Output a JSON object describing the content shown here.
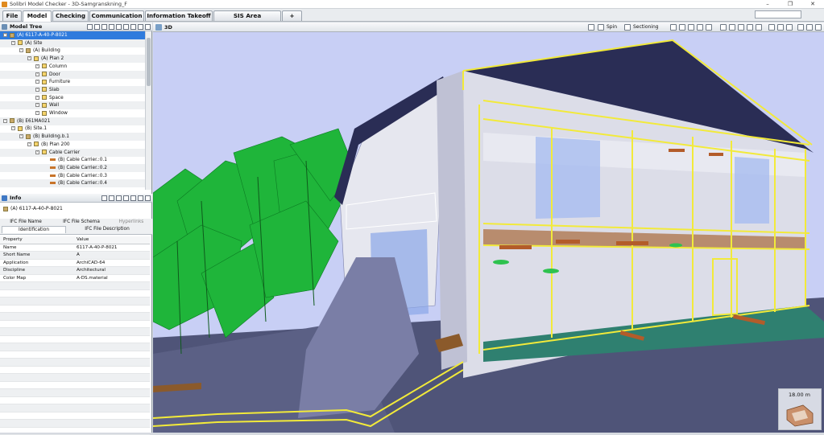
{
  "window": {
    "title": "Solibri Model Checker - 3D-Samgranskning_F",
    "controls": [
      "–",
      "❐",
      "✕"
    ]
  },
  "tabs": [
    {
      "label": "File",
      "active": false
    },
    {
      "label": "Model",
      "active": true
    },
    {
      "label": "Checking",
      "active": false
    },
    {
      "label": "Communication",
      "active": false
    },
    {
      "label": "Information Takeoff",
      "active": false
    },
    {
      "label": "SIS Area Calculation",
      "active": false
    },
    {
      "label": "+",
      "active": false
    }
  ],
  "model_tree": {
    "title": "Model Tree",
    "rows": [
      {
        "text": "(A) 6117-A-40-P-8021",
        "indent": 0,
        "icon": "bldg",
        "selected": true
      },
      {
        "text": "(A) Site",
        "indent": 1,
        "icon": "folder"
      },
      {
        "text": "(A) Building",
        "indent": 2,
        "icon": "bldg"
      },
      {
        "text": "(A) Plan 2",
        "indent": 3,
        "icon": "folder"
      },
      {
        "text": "Column",
        "indent": 4,
        "icon": "folder"
      },
      {
        "text": "Door",
        "indent": 4,
        "icon": "folder"
      },
      {
        "text": "Furniture",
        "indent": 4,
        "icon": "folder"
      },
      {
        "text": "Slab",
        "indent": 4,
        "icon": "folder"
      },
      {
        "text": "Space",
        "indent": 4,
        "icon": "folder"
      },
      {
        "text": "Wall",
        "indent": 4,
        "icon": "folder"
      },
      {
        "text": "Window",
        "indent": 4,
        "icon": "folder"
      },
      {
        "text": "(B) E61MA021",
        "indent": 0,
        "icon": "bldg"
      },
      {
        "text": "(B) Site.1",
        "indent": 1,
        "icon": "folder"
      },
      {
        "text": "(B) Building.b.1",
        "indent": 2,
        "icon": "bldg"
      },
      {
        "text": "(B) Plan 200",
        "indent": 3,
        "icon": "folder"
      },
      {
        "text": "Cable Carrier",
        "indent": 4,
        "icon": "folder"
      },
      {
        "text": "(B) Cable Carrier.:0.1",
        "indent": 5,
        "icon": "cable"
      },
      {
        "text": "(B) Cable Carrier.:0.2",
        "indent": 5,
        "icon": "cable"
      },
      {
        "text": "(B) Cable Carrier.:0.3",
        "indent": 5,
        "icon": "cable"
      },
      {
        "text": "(B) Cable Carrier.:0.4",
        "indent": 5,
        "icon": "cable"
      }
    ]
  },
  "info": {
    "title": "Info",
    "selected": "(A) 6117-A-40-P-8021",
    "tabs_row1": [
      "IFC File Name",
      "IFC File Schema",
      "Hyperlinks"
    ],
    "tabs_row2": [
      "Identification",
      "IFC File Description"
    ],
    "columns": [
      "Property",
      "Value"
    ],
    "rows": [
      {
        "property": "Name",
        "value": "6117-A-40-P-8021"
      },
      {
        "property": "Short Name",
        "value": "A"
      },
      {
        "property": "Application",
        "value": "ArchiCAD-64"
      },
      {
        "property": "Discipline",
        "value": "Architectural"
      },
      {
        "property": "Color Map",
        "value": "A-DS.material"
      }
    ]
  },
  "view3d": {
    "title": "3D",
    "spin_label": "Spin",
    "sectioning_label": "Sectioning",
    "scale_text": "18.00 m"
  },
  "colors": {
    "accent": "#2f7bdd",
    "sky": "#c8cff5",
    "roof": "#2a2d55",
    "highlight": "#f2ea3a",
    "vegetation": "#1fb53a"
  }
}
